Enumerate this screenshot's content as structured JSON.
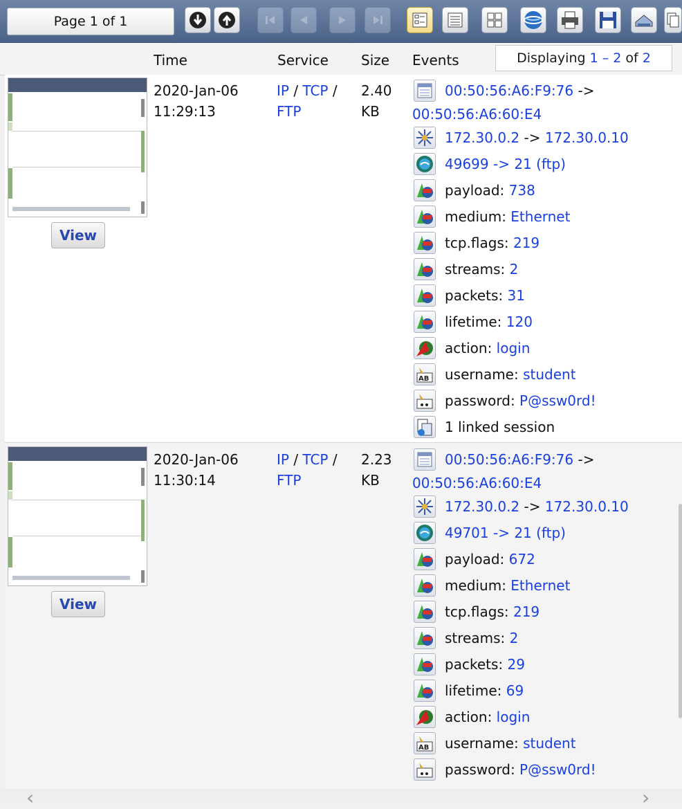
{
  "toolbar": {
    "page_label": "Page 1 of 1",
    "buttons": [
      "download-icon",
      "upload-icon",
      "first-page-icon",
      "prev-page-icon",
      "next-page-icon",
      "last-page-icon",
      "detail-view-icon",
      "list-view-icon",
      "grid-view-icon",
      "globe-icon",
      "print-icon",
      "save-icon",
      "export-icon",
      "copy-icon"
    ]
  },
  "header": {
    "time": "Time",
    "service": "Service",
    "size": "Size",
    "events": "Events",
    "displaying": {
      "prefix": "Displaying ",
      "from": "1",
      "dash": " – ",
      "to": "2",
      "of": " of ",
      "total": "2"
    }
  },
  "sessions": [
    {
      "view_label": "View",
      "date": "2020-Jan-06",
      "time": "11:29:13",
      "service": {
        "ip": "IP",
        "slash1": " / ",
        "tcp": "TCP",
        "slash2": " /",
        "ftp": "FTP"
      },
      "size_value": "2.40",
      "size_unit": "KB",
      "mac_src": "00:50:56:A6:F9:76",
      "mac_arrow": " ->",
      "mac_dst": "00:50:56:A6:60:E4",
      "ip_src": "172.30.0.2",
      "ip_arrow": " -> ",
      "ip_dst": "172.30.0.10",
      "port": "49699 -> 21 (ftp)",
      "attrs": [
        {
          "k": "payload: ",
          "v": "738"
        },
        {
          "k": "medium: ",
          "v": "Ethernet"
        },
        {
          "k": "tcp.flags: ",
          "v": "219"
        },
        {
          "k": "streams: ",
          "v": "2"
        },
        {
          "k": "packets: ",
          "v": "31"
        },
        {
          "k": "lifetime: ",
          "v": "120"
        }
      ],
      "action": {
        "k": "action: ",
        "v": "login"
      },
      "username": {
        "k": "username: ",
        "v": "student"
      },
      "password": {
        "k": "password: ",
        "v": "P@ssw0rd!"
      },
      "linked": "1 linked session"
    },
    {
      "view_label": "View",
      "date": "2020-Jan-06",
      "time": "11:30:14",
      "service": {
        "ip": "IP",
        "slash1": " / ",
        "tcp": "TCP",
        "slash2": " /",
        "ftp": "FTP"
      },
      "size_value": "2.23",
      "size_unit": "KB",
      "mac_src": "00:50:56:A6:F9:76",
      "mac_arrow": " ->",
      "mac_dst": "00:50:56:A6:60:E4",
      "ip_src": "172.30.0.2",
      "ip_arrow": " -> ",
      "ip_dst": "172.30.0.10",
      "port": "49701 -> 21 (ftp)",
      "attrs": [
        {
          "k": "payload: ",
          "v": "672"
        },
        {
          "k": "medium: ",
          "v": "Ethernet"
        },
        {
          "k": "tcp.flags: ",
          "v": "219"
        },
        {
          "k": "streams: ",
          "v": "2"
        },
        {
          "k": "packets: ",
          "v": "29"
        },
        {
          "k": "lifetime: ",
          "v": "69"
        }
      ],
      "action": {
        "k": "action: ",
        "v": "login"
      },
      "username": {
        "k": "username: ",
        "v": "student"
      },
      "password": {
        "k": "password: ",
        "v": "P@ssw0rd!"
      }
    }
  ]
}
